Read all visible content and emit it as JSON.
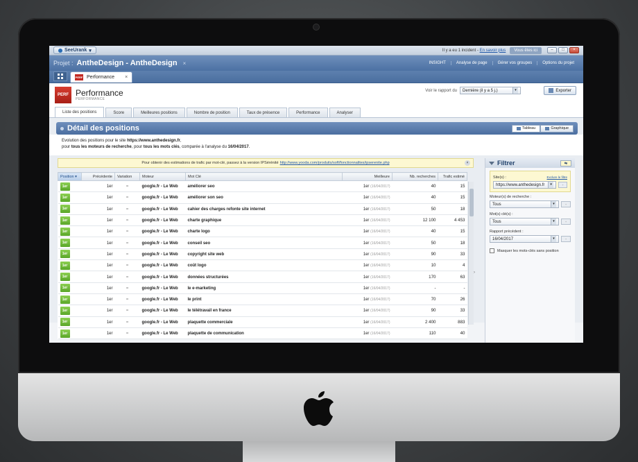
{
  "titlebar": {
    "brand": "SeeUrank",
    "incident_text": "Il y a eu 1 incident -",
    "incident_link": "En savoir plus",
    "user_button": "Vous êtes ici"
  },
  "project": {
    "label": "Projet :",
    "name": "AntheDesign - AntheDesign",
    "links": [
      "INSIGHT",
      "Analyse de page",
      "Gérer vos groupes",
      "Options du projet"
    ]
  },
  "doc_tab": {
    "badge": "PERF",
    "label": "Performance",
    "close": "×"
  },
  "header": {
    "logo": "PERF",
    "title": "Performance",
    "subtitle": "PERFORMANCE",
    "report_label": "Voir le rapport du",
    "report_value": "Dernière (il y a 5 j.)",
    "export_label": "Exporter"
  },
  "subtabs": [
    "Liste des positions",
    "Score",
    "Meilleures positions",
    "Nombre de position",
    "Taux de présence",
    "Performance",
    "Analyser"
  ],
  "section": {
    "title": "Détail des positions",
    "view_table": "Tableau",
    "view_chart": "Graphique"
  },
  "evolution": {
    "line1_prefix": "Evolution des positions pour le site",
    "site": "https://www.anthedesign.fr",
    "line2_prefix": "pour",
    "engines": "tous les moteurs de recherche",
    "line2_mid": ", pour",
    "keywords": "tous les mots clés",
    "line2_suffix": ", comparée à l'analyse du",
    "date": "16/04/2017"
  },
  "notice": {
    "text": "Pour obtenir des estimations de trafic par mot-clé, passez à la version IPSérénité",
    "link": "http://www.yooda.com/produits/soft/fonctionnalites/ipserenite.php"
  },
  "table": {
    "headers": [
      "Position",
      "Précédente",
      "Variation",
      "Moteur",
      "Mot Clé",
      "Meilleure",
      "Nb. recherches",
      "Trafic estimé"
    ],
    "rows": [
      {
        "pos": "1er",
        "prev": "1er",
        "var": "=",
        "engine": "google.fr - Le Web",
        "kw": "améliorer seo",
        "best": "1er",
        "best_date": "(16/04/2017)",
        "searches": "40",
        "traffic": "15"
      },
      {
        "pos": "1er",
        "prev": "1er",
        "var": "=",
        "engine": "google.fr - Le Web",
        "kw": "améliorer son seo",
        "best": "1er",
        "best_date": "(16/04/2017)",
        "searches": "40",
        "traffic": "15"
      },
      {
        "pos": "1er",
        "prev": "1er",
        "var": "=",
        "engine": "google.fr - Le Web",
        "kw": "cahier des charges refonte site internet",
        "best": "1er",
        "best_date": "(16/04/2017)",
        "searches": "50",
        "traffic": "18"
      },
      {
        "pos": "1er",
        "prev": "1er",
        "var": "=",
        "engine": "google.fr - Le Web",
        "kw": "charte graphique",
        "best": "1er",
        "best_date": "(16/04/2017)",
        "searches": "12 100",
        "traffic": "4 453"
      },
      {
        "pos": "1er",
        "prev": "1er",
        "var": "=",
        "engine": "google.fr - Le Web",
        "kw": "charte logo",
        "best": "1er",
        "best_date": "(16/04/2017)",
        "searches": "40",
        "traffic": "15"
      },
      {
        "pos": "1er",
        "prev": "1er",
        "var": "=",
        "engine": "google.fr - Le Web",
        "kw": "conseil seo",
        "best": "1er",
        "best_date": "(16/04/2017)",
        "searches": "50",
        "traffic": "18"
      },
      {
        "pos": "1er",
        "prev": "1er",
        "var": "=",
        "engine": "google.fr - Le Web",
        "kw": "copyright site web",
        "best": "1er",
        "best_date": "(16/04/2017)",
        "searches": "90",
        "traffic": "33"
      },
      {
        "pos": "1er",
        "prev": "1er",
        "var": "=",
        "engine": "google.fr - Le Web",
        "kw": "coût logo",
        "best": "1er",
        "best_date": "(16/04/2017)",
        "searches": "10",
        "traffic": "4"
      },
      {
        "pos": "1er",
        "prev": "1er",
        "var": "=",
        "engine": "google.fr - Le Web",
        "kw": "données structurées",
        "best": "1er",
        "best_date": "(16/04/2017)",
        "searches": "170",
        "traffic": "63"
      },
      {
        "pos": "1er",
        "prev": "1er",
        "var": "=",
        "engine": "google.fr - Le Web",
        "kw": "le e-marketing",
        "best": "1er",
        "best_date": "(16/04/2017)",
        "searches": "-",
        "traffic": "-"
      },
      {
        "pos": "1er",
        "prev": "1er",
        "var": "=",
        "engine": "google.fr - Le Web",
        "kw": "le print",
        "best": "1er",
        "best_date": "(16/04/2017)",
        "searches": "70",
        "traffic": "26"
      },
      {
        "pos": "1er",
        "prev": "1er",
        "var": "=",
        "engine": "google.fr - Le Web",
        "kw": "le télétravail en france",
        "best": "1er",
        "best_date": "(16/04/2017)",
        "searches": "90",
        "traffic": "33"
      },
      {
        "pos": "1er",
        "prev": "1er",
        "var": "=",
        "engine": "google.fr - Le Web",
        "kw": "plaquette commerciale",
        "best": "1er",
        "best_date": "(16/04/2017)",
        "searches": "2 400",
        "traffic": "883"
      },
      {
        "pos": "1er",
        "prev": "1er",
        "var": "=",
        "engine": "google.fr - Le Web",
        "kw": "plaquette de communication",
        "best": "1er",
        "best_date": "(16/04/2017)",
        "searches": "110",
        "traffic": "40"
      }
    ]
  },
  "filter": {
    "title": "Filtrer",
    "site_label": "Site(s) :",
    "site_link": "Exclure le filtre",
    "site_value": "https://www.anthedesign.fr",
    "engine_label": "Moteur(s) de recherche :",
    "engine_value": "Tous",
    "keyword_label": "Mot(s) clé(s) :",
    "keyword_value": "Tous",
    "report_label": "Rapport précédent :",
    "report_value": "16/04/2017",
    "hide_label": "Masquer les mots-clés sans position"
  },
  "colors": {
    "accent": "#4b6ea0",
    "badge_green": "#5aa629",
    "perf_red": "#c32a22"
  }
}
